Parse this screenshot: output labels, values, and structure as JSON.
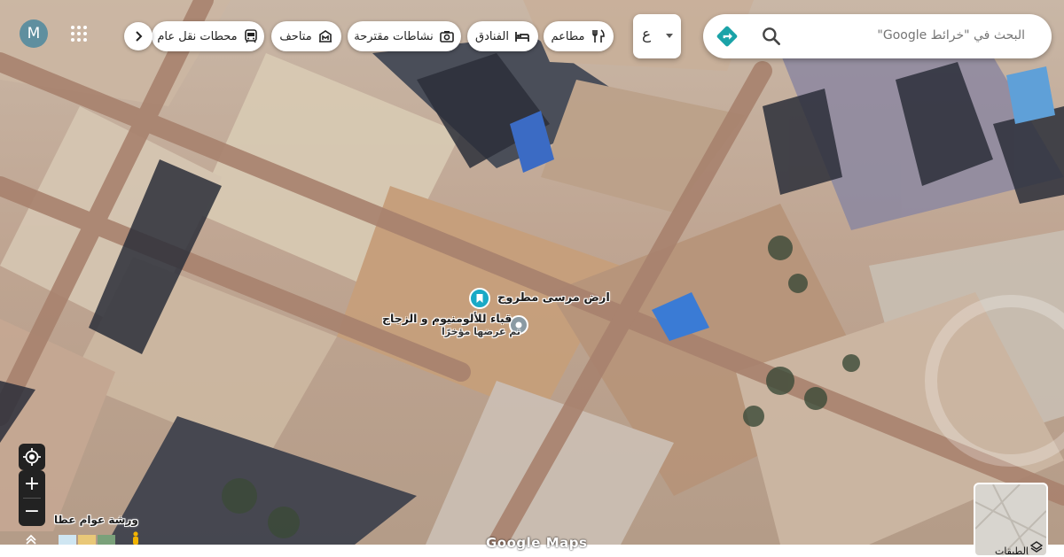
{
  "search": {
    "placeholder": "البحث في \"خرائط Google\""
  },
  "language_selector": {
    "value": "ع"
  },
  "chips": [
    {
      "label": "مطاعم",
      "icon": "restaurant-icon"
    },
    {
      "label": "الفنادق",
      "icon": "hotel-icon"
    },
    {
      "label": "نشاطات مقترحة",
      "icon": "camera-icon"
    },
    {
      "label": "متاحف",
      "icon": "museum-icon"
    },
    {
      "label": "محطات نقل عام",
      "icon": "transit-icon"
    }
  ],
  "account": {
    "initial": "M"
  },
  "places": [
    {
      "name": "ارض مرسى مطروح",
      "type": "saved"
    },
    {
      "name": "قباء للألومنيوم و الزجاج",
      "subtitle": "تم عرضها مؤخرًا"
    },
    {
      "name": "ورشة عوام عطا"
    }
  ],
  "layers": {
    "label": "الطبقات"
  },
  "zoom": {
    "in": "+",
    "out": "−"
  },
  "branding": {
    "text": "Google Maps"
  },
  "colors": {
    "accent": "#1aa3a8",
    "saved_pin": "#19a9c6",
    "recent_pin": "#8a9aa3"
  }
}
